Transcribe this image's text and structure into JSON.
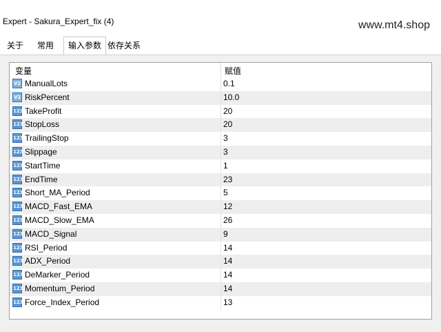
{
  "window": {
    "title": "Expert - Sakura_Expert_fix (4)"
  },
  "watermark": "www.mt4.shop",
  "tabs": [
    {
      "label": "关于",
      "active": false
    },
    {
      "label": "常用",
      "active": false
    },
    {
      "label": "输入参数",
      "active": true
    },
    {
      "label": "依存关系",
      "active": false
    }
  ],
  "table": {
    "headers": {
      "variable": "变量",
      "value": "赋值"
    },
    "rows": [
      {
        "name": "ManualLots",
        "value": "0.1",
        "icon": "double-type-icon",
        "icon_text": "V2"
      },
      {
        "name": "RiskPercent",
        "value": "10.0",
        "icon": "double-type-icon",
        "icon_text": "V2"
      },
      {
        "name": "TakeProfit",
        "value": "20",
        "icon": "integer-type-icon",
        "icon_text": "123"
      },
      {
        "name": "StopLoss",
        "value": "20",
        "icon": "integer-type-icon",
        "icon_text": "123"
      },
      {
        "name": "TrailingStop",
        "value": "3",
        "icon": "integer-type-icon",
        "icon_text": "123"
      },
      {
        "name": "Slippage",
        "value": "3",
        "icon": "integer-type-icon",
        "icon_text": "123"
      },
      {
        "name": "StartTime",
        "value": "1",
        "icon": "integer-type-icon",
        "icon_text": "123"
      },
      {
        "name": "EndTime",
        "value": "23",
        "icon": "integer-type-icon",
        "icon_text": "123"
      },
      {
        "name": "Short_MA_Period",
        "value": "5",
        "icon": "integer-type-icon",
        "icon_text": "123"
      },
      {
        "name": "MACD_Fast_EMA",
        "value": "12",
        "icon": "integer-type-icon",
        "icon_text": "123"
      },
      {
        "name": "MACD_Slow_EMA",
        "value": "26",
        "icon": "integer-type-icon",
        "icon_text": "123"
      },
      {
        "name": "MACD_Signal",
        "value": "9",
        "icon": "integer-type-icon",
        "icon_text": "123"
      },
      {
        "name": "RSI_Period",
        "value": "14",
        "icon": "integer-type-icon",
        "icon_text": "123"
      },
      {
        "name": "ADX_Period",
        "value": "14",
        "icon": "integer-type-icon",
        "icon_text": "123"
      },
      {
        "name": "DeMarker_Period",
        "value": "14",
        "icon": "integer-type-icon",
        "icon_text": "123"
      },
      {
        "name": "Momentum_Period",
        "value": "14",
        "icon": "integer-type-icon",
        "icon_text": "123"
      },
      {
        "name": "Force_Index_Period",
        "value": "13",
        "icon": "integer-type-icon",
        "icon_text": "123"
      }
    ]
  }
}
